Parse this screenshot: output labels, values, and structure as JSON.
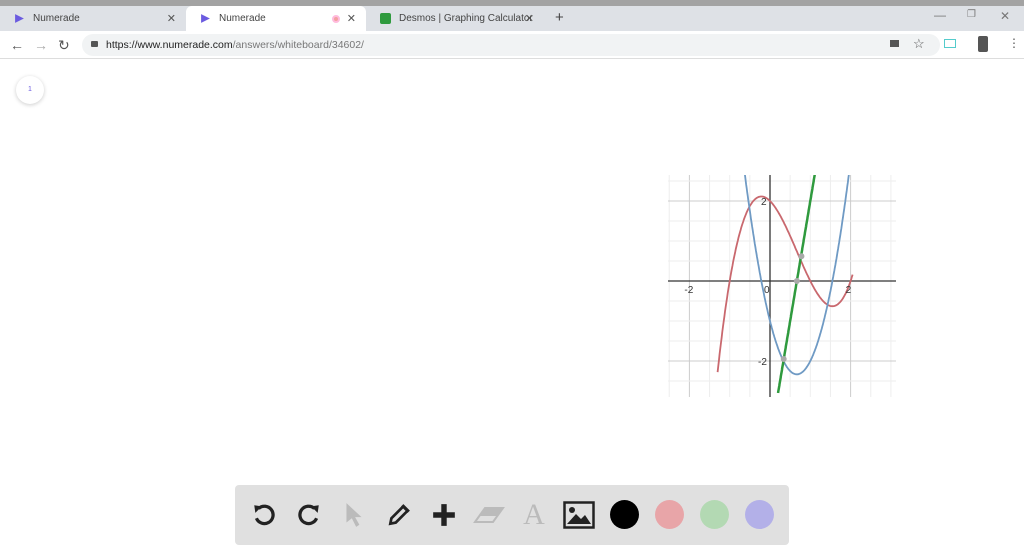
{
  "browser": {
    "tabs": [
      {
        "label": "Numerade",
        "active": false
      },
      {
        "label": "Numerade",
        "active": true
      },
      {
        "label": "Desmos | Graphing Calculator",
        "active": false
      }
    ],
    "url_host": "https://www.numerade.com",
    "url_path": "/answers/whiteboard/34602/"
  },
  "page": {
    "page_number": "1"
  },
  "graph": {
    "x_ticks": [
      "-2",
      "0",
      "2"
    ],
    "y_ticks": [
      "2",
      "-2"
    ],
    "curves": [
      {
        "name": "f(x)=(x+1)(x-1)(x-2)",
        "color": "#c9686e",
        "xrange": [
          -1.3,
          2.05
        ]
      },
      {
        "name": "f'(x)=3x^2-4x-1",
        "color": "#6f9ac4",
        "xrange": [
          -0.7,
          2.0
        ]
      },
      {
        "name": "f''(x)=6x-4",
        "color": "#2f9a3e",
        "xrange": [
          0.2,
          1.12
        ]
      }
    ],
    "points": [
      [
        0.667,
        0
      ],
      [
        0.78,
        0.62
      ],
      [
        0.34,
        -1.95
      ]
    ]
  },
  "toolbar": {
    "tools": [
      "undo",
      "redo",
      "select",
      "pen",
      "add",
      "eraser",
      "text",
      "image"
    ],
    "colors": [
      "#000000",
      "#e8a5a8",
      "#b3d9b3",
      "#b3b0e8"
    ]
  }
}
